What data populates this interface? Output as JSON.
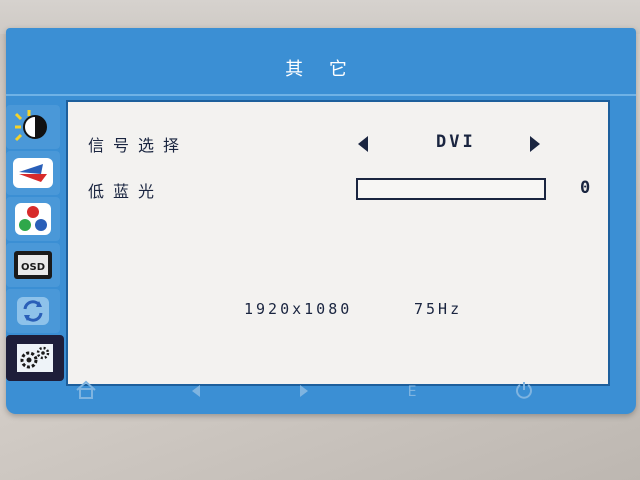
{
  "menu": {
    "title": "其 它"
  },
  "tabs": [
    {
      "icon": "brightness-icon"
    },
    {
      "icon": "image-icon"
    },
    {
      "icon": "color-icon"
    },
    {
      "icon": "osd-icon",
      "label": "OSD"
    },
    {
      "icon": "reset-icon"
    },
    {
      "icon": "settings-icon"
    }
  ],
  "settings": {
    "signal_select": {
      "label": "信号选择",
      "value": "DVI"
    },
    "low_blue_light": {
      "label": "低蓝光",
      "value": "0",
      "level_fraction": 0
    }
  },
  "status": {
    "resolution": "1920x1080",
    "refresh_rate": "75Hz"
  },
  "buttons": [
    {
      "icon": "home-icon"
    },
    {
      "icon": "left-arrow-icon"
    },
    {
      "icon": "right-arrow-icon"
    },
    {
      "icon": "enter-icon",
      "label": "E"
    },
    {
      "icon": "power-icon"
    }
  ],
  "colors": {
    "osd_blue": "#3b8fd4",
    "panel_bg": "#f3f2f0",
    "text_dark": "#1a2540"
  }
}
